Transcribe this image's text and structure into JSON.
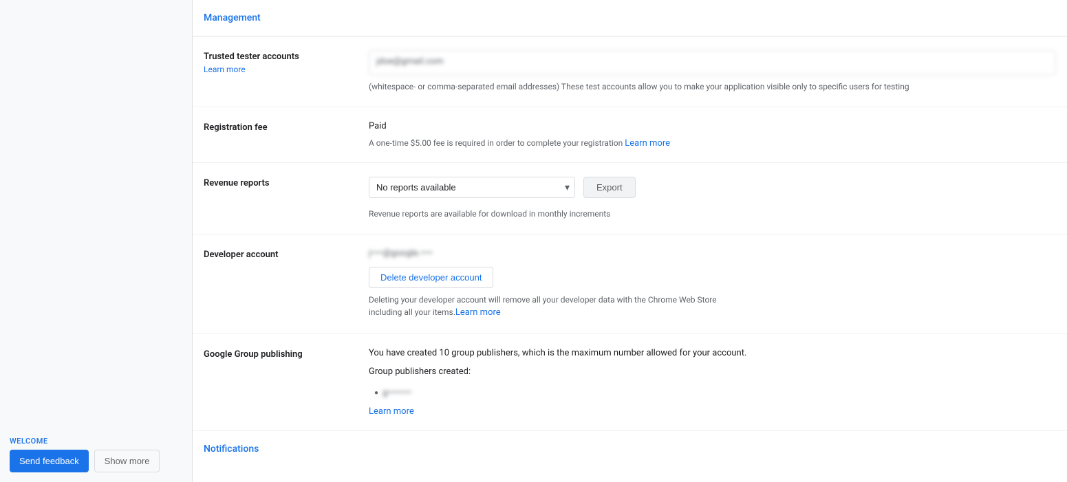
{
  "leftPanel": {
    "welcomeLabel": "WELCOME",
    "sendFeedbackLabel": "Send feedback",
    "showMoreLabel": "Show more"
  },
  "management": {
    "sectionTitle": "Management",
    "trustedTesterAccounts": {
      "label": "Trusted tester accounts",
      "learnMoreLink": "Learn more",
      "emailPlaceholder": "jdoe@gmail.com",
      "hintText": "(whitespace- or comma-separated email addresses) These test accounts allow you to make your application visible only to specific users for testing"
    },
    "registrationFee": {
      "label": "Registration fee",
      "statusText": "Paid",
      "feeHintText": "A one-time $5.00 fee is required in order to complete your registration",
      "learnMoreLink": "Learn more"
    },
    "revenueReports": {
      "label": "Revenue reports",
      "dropdownPlaceholder": "No reports available",
      "exportButtonLabel": "Export",
      "hintText": "Revenue reports are available for download in monthly increments"
    },
    "developerAccount": {
      "label": "Developer account",
      "accountEmail": "j••••@google.••••",
      "deleteButtonLabel": "Delete developer account",
      "deleteHintText": "Deleting your developer account will remove all your developer data with the Chrome Web Store including all your items.",
      "learnMoreLink": "Learn more"
    },
    "googleGroupPublishing": {
      "label": "Google Group publishing",
      "descText": "You have created 10 group publishers, which is the maximum number allowed for your account.",
      "subLabel": "Group publishers created:",
      "groupEmail": "g••••••••",
      "learnMoreLink": "Learn more"
    }
  },
  "notifications": {
    "sectionTitle": "Notifications"
  }
}
